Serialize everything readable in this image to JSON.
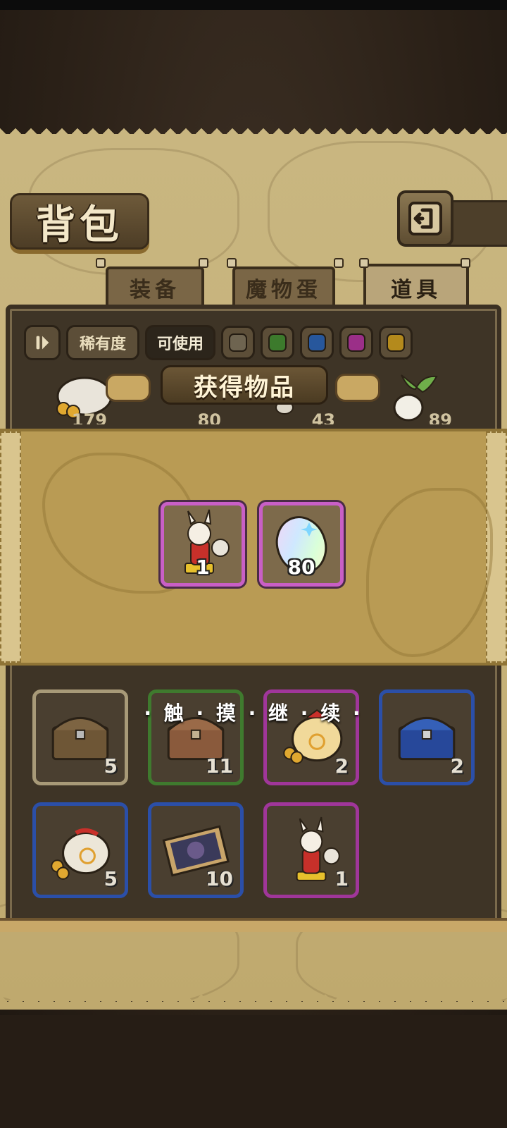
{
  "header": {
    "title": "背包"
  },
  "tabs": [
    {
      "label": "装备",
      "active": false
    },
    {
      "label": "魔物蛋",
      "active": false
    },
    {
      "label": "道具",
      "active": true
    }
  ],
  "filters": {
    "rarity_label": "稀有度",
    "usable_label": "可使用",
    "swatch_colors": [
      "#6e6450",
      "#3c7a2c",
      "#27579c",
      "#9b2f88",
      "#b48a1c"
    ]
  },
  "peek_counts": [
    "179",
    "80",
    "43",
    "89"
  ],
  "popup": {
    "title": "获得物品",
    "rewards": [
      {
        "icon": "character-figure-icon",
        "count": "1"
      },
      {
        "icon": "rainbow-egg-icon",
        "count": "80"
      }
    ],
    "continue_text": "· 触 · 摸 · 继 · 续 ·"
  },
  "inventory": [
    {
      "icon": "wooden-chest-icon",
      "count": "5",
      "rarity": "gray"
    },
    {
      "icon": "wooden-chest-icon",
      "count": "11",
      "rarity": "green"
    },
    {
      "icon": "coin-bag-icon",
      "count": "2",
      "rarity": "purple"
    },
    {
      "icon": "blue-chest-icon",
      "count": "2",
      "rarity": "blue"
    },
    {
      "icon": "coin-bag-icon",
      "count": "5",
      "rarity": "blue"
    },
    {
      "icon": "portrait-card-icon",
      "count": "10",
      "rarity": "blue"
    },
    {
      "icon": "character-figure-icon",
      "count": "1",
      "rarity": "purple"
    }
  ]
}
